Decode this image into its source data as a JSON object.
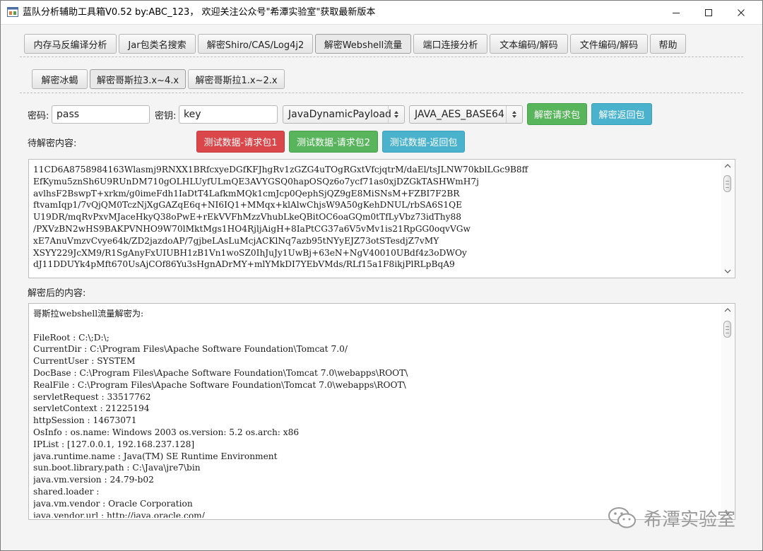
{
  "window": {
    "title": "蓝队分析辅助工具箱V0.52 by:ABC_123， 欢迎关注公众号\"希潭实验室\"获取最新版本",
    "minimize_glyph": "—",
    "maximize_glyph": "☐",
    "close_glyph": "✕"
  },
  "main_tabs": [
    {
      "label": "内存马反编译分析"
    },
    {
      "label": "Jar包类名搜索"
    },
    {
      "label": "解密Shiro/CAS/Log4j2"
    },
    {
      "label": "解密Webshell流量"
    },
    {
      "label": "端口连接分析"
    },
    {
      "label": "文本编码/解码"
    },
    {
      "label": "文件编码/解码"
    },
    {
      "label": "帮助"
    }
  ],
  "sub_tabs": [
    {
      "label": "解密冰蝎"
    },
    {
      "label": "解密哥斯拉3.x~4.x"
    },
    {
      "label": "解密哥斯拉1.x~2.x"
    }
  ],
  "form": {
    "password_label": "密码:",
    "password_value": "pass",
    "key_label": "密钥:",
    "key_value": "key",
    "payload_select": "JavaDynamicPayload",
    "cipher_select": "JAVA_AES_BASE64",
    "decrypt_request_button": "解密请求包",
    "decrypt_response_button": "解密返回包",
    "to_decrypt_label": "待解密内容:",
    "test_request1_button": "测试数据-请求包1",
    "test_request2_button": "测试数据-请求包2",
    "test_response_button": "测试数据-返回包",
    "decrypted_label": "解密后的内容:"
  },
  "input_content": "11CD6A8758984163Wlasmj9RNXX1BRfcxyeDGfKFJhgRv1zGZG4uTOgRGxtVfcjqtrM/daEl/tsJLNW70kblLGc9B8ff\nEfKymu5znSh6U9RUnDM710gOLHLUyfULmQE3AVYGSQ0hapOSQz6o7ycf71as0xjDZGkTASHWmH7j\navlhsF2BswpT+xrkm/g0imeFdh1IaDtT4LafkmMQk1cmJcp0QephSjQZ9gE8MiSNsM+FZBI7F2BR\nftvamIqp1/7vQjQM0TczNjXgGAZqE6q+NI6IQ1+MMqx+klAlwChjsW9A50gKehDNUL/rbSA6S1QE\nU19DR/mqRvPxvMJaceHkyQ38oPwE+rEkVVFhMzzVhubLkeQBitOC6oaGQm0tTfLyVbz73idThy88\n/PXVzBN2wHS9BAKPVNHO9W70lMktMgs1HO4RjljAigH+8IaPtCG37a6V5vMv1is21RpGG0oqvVGw\nxE7AnuVmzvCvye64k/ZD2jazdoAP/7gjbeLAsLuMcjACKlNq7azb95tNYyEJZ73otSTesdjZ7vMY\nXSYY229JcXM9/R1SgAnyFxUIUBH1zB1Vn1woSZ0IhJuJy1UwBj+63eN+NgV40010UBdf4z3oDWOy\ndJ11DDUYk4pMft670UsAjCOf86Yu3sHgnADrMY+mlYMkDI7YEbVMds/RLf15a1F8ikjPlRLpBqA9",
  "output_content": "哥斯拉webshell流量解密为:\n\nFileRoot : C:\\;D:\\;\nCurrentDir : C:\\Program Files\\Apache Software Foundation\\Tomcat 7.0/\nCurrentUser : SYSTEM\nDocBase : C:\\Program Files\\Apache Software Foundation\\Tomcat 7.0\\webapps\\ROOT\\\nRealFile : C:\\Program Files\\Apache Software Foundation\\Tomcat 7.0\\webapps\\ROOT\\\nservletRequest : 33517762\nservletContext : 21225194\nhttpSession : 14673071\nOsInfo : os.name: Windows 2003 os.version: 5.2 os.arch: x86\nIPList : [127.0.0.1, 192.168.237.128]\njava.runtime.name : Java(TM) SE Runtime Environment\nsun.boot.library.path : C:\\Java\\jre7\\bin\njava.vm.version : 24.79-b02\nshared.loader :\njava.vm.vendor : Oracle Corporation\njava.vendor.url : http://java.oracle.com/",
  "watermark": "希潭实验室",
  "colors": {
    "red": "#d9474a",
    "green": "#58b55c",
    "teal": "#4ab2cc"
  },
  "icons": {
    "app": "app-icon",
    "scroll_up": "chevron-up-icon",
    "scroll_down": "chevron-down-icon",
    "select_arrow": "updown-arrows-icon",
    "wechat": "wechat-icon"
  }
}
